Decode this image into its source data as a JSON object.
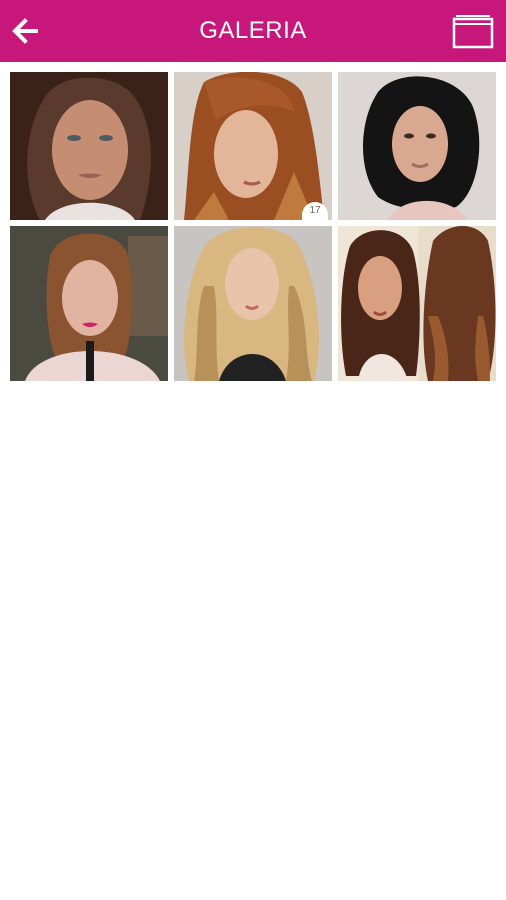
{
  "header": {
    "title": "GALERIA",
    "background": "#c8177a",
    "back_icon": "arrow-left-icon",
    "folder_icon": "folder-icon"
  },
  "gallery": {
    "images": [
      {
        "name": "photo-1",
        "description_icon": "portrait-dark-hair"
      },
      {
        "name": "photo-2",
        "description_icon": "portrait-auburn-bangs",
        "badge": "17"
      },
      {
        "name": "photo-3",
        "description_icon": "portrait-black-bob"
      },
      {
        "name": "photo-4",
        "description_icon": "portrait-brown-lob"
      },
      {
        "name": "photo-5",
        "description_icon": "portrait-blonde-waves"
      },
      {
        "name": "photo-6",
        "description_icon": "portrait-long-brunette-layers"
      }
    ]
  }
}
